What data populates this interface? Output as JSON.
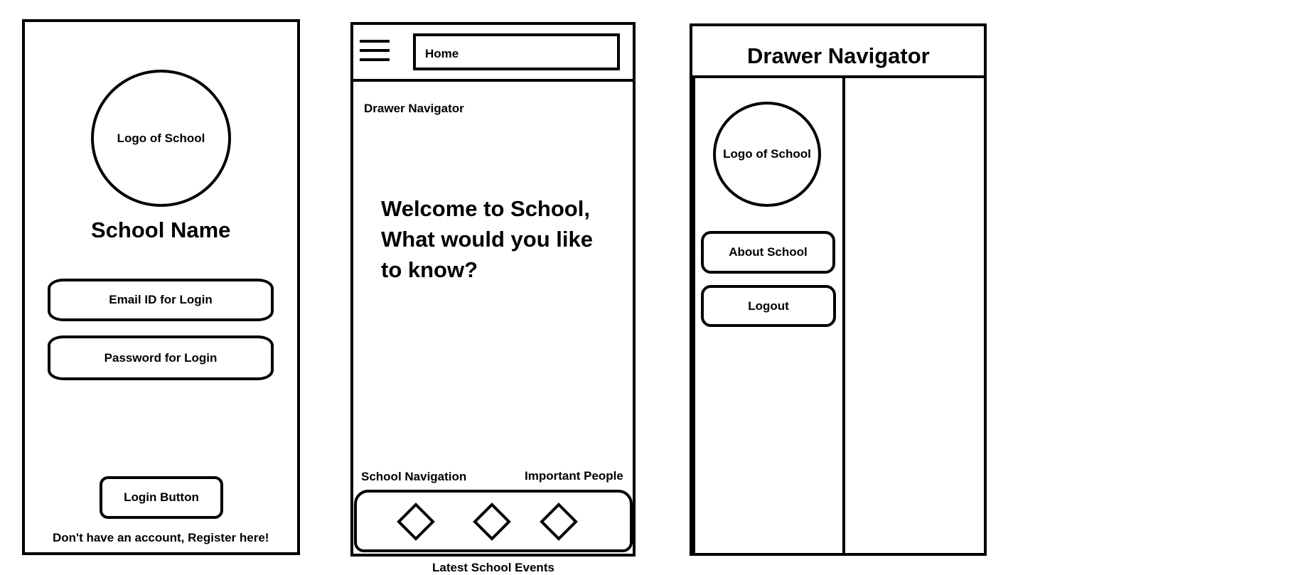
{
  "login_screen": {
    "logo_text": "Logo of School",
    "school_name": "School Name",
    "email_field": "Email ID for Login",
    "password_field": "Password for Login",
    "login_button": "Login Button",
    "register_link": "Don't have an account, Register here!"
  },
  "home_screen": {
    "header_title": "Home",
    "drawer_label": "Drawer Navigator",
    "welcome_line1": "Welcome to School,",
    "welcome_line2": "What would you like",
    "welcome_line3": "to know?",
    "bottom_left_label": "School Navigation",
    "bottom_right_label": "Important People",
    "bottom_caption": "Latest School Events"
  },
  "drawer_screen": {
    "title": "Drawer Navigator",
    "logo_text": "Logo of School",
    "about_button": "About School",
    "logout_button": "Logout"
  },
  "icons": {
    "menu": "hamburger-menu-icon",
    "tab": "diamond-icon"
  }
}
